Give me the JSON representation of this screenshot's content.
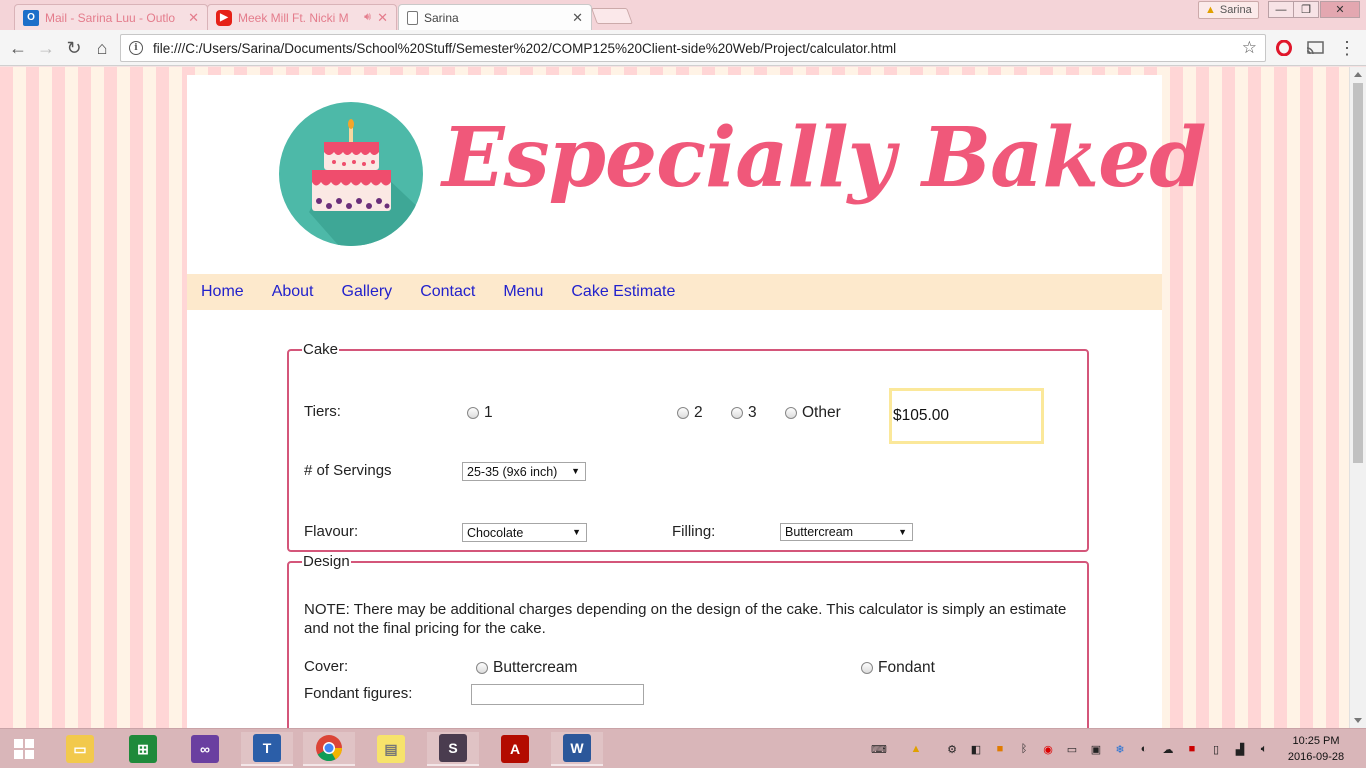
{
  "browser": {
    "tabs": [
      {
        "title": "Mail - Sarina Luu - Outlo",
        "favicon": "outlook-icon",
        "active": false
      },
      {
        "title": "Meek Mill Ft. Nicki M",
        "favicon": "youtube-icon",
        "active": false
      },
      {
        "title": "Sarina",
        "favicon": "document-icon",
        "active": true
      }
    ],
    "profile_name": "Sarina",
    "url": "file:///C:/Users/Sarina/Documents/School%20Stuff/Semester%202/COMP125%20Client-side%20Web/Project/calculator.html"
  },
  "site": {
    "brand": "Especially Baked",
    "nav": [
      "Home",
      "About",
      "Gallery",
      "Contact",
      "Menu",
      "Cake Estimate"
    ]
  },
  "cake": {
    "legend": "Cake",
    "tiers_label": "Tiers:",
    "tier_options": [
      "1",
      "2",
      "3",
      "Other"
    ],
    "price": "$105.00",
    "servings_label": "# of Servings",
    "servings_value": "25-35 (9x6 inch)",
    "flavour_label": "Flavour:",
    "flavour_value": "Chocolate",
    "filling_label": "Filling:",
    "filling_value": "Buttercream"
  },
  "design": {
    "legend": "Design",
    "note": "NOTE: There may be additional charges depending on the design of the cake. This calculator is simply an estimate and not the final pricing for the cake.",
    "cover_label": "Cover:",
    "cover_options": [
      "Buttercream",
      "Fondant"
    ],
    "fondant_label": "Fondant figures:",
    "fondant_value": ""
  },
  "taskbar": {
    "time": "10:25 PM",
    "date": "2016-09-28"
  },
  "colors": {
    "brand_pink": "#f0587a",
    "nav_bg": "#fde9cc",
    "fieldset_border": "#d4567a",
    "price_border": "#fbe89a",
    "logo_teal": "#4db9a8"
  }
}
